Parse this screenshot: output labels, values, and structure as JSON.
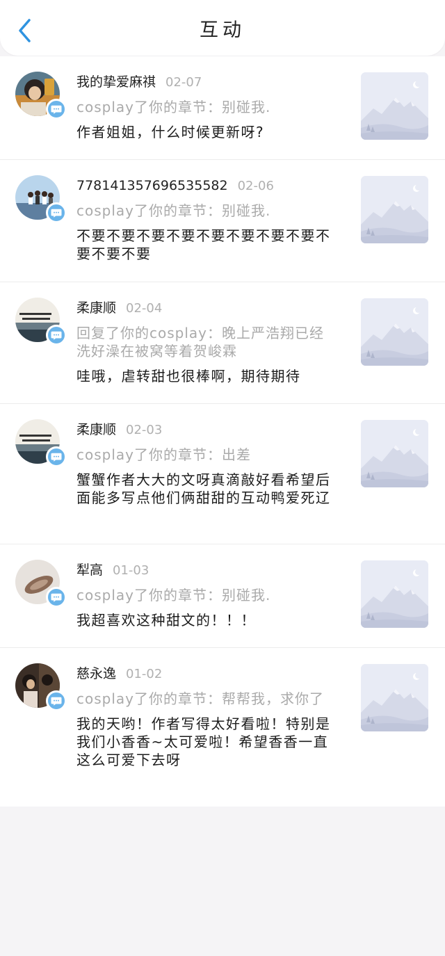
{
  "header": {
    "title": "互动",
    "back_icon": "chevron-left-icon",
    "accent": "#2f93e0"
  },
  "items": [
    {
      "name": "我的挚爱麻祺",
      "date": "02-07",
      "quote": "cosplay了你的章节：别碰我.",
      "message": "作者姐姐，什么时候更新呀?",
      "avatar": "photo-avatar-1"
    },
    {
      "name": "778141357696535582",
      "date": "02-06",
      "quote": "cosplay了你的章节：别碰我.",
      "message": "不要不要不要不要不要不要不要不要不要不要不要",
      "avatar": "photo-avatar-2"
    },
    {
      "name": "柔康顺",
      "date": "02-04",
      "quote": "回复了你的cosplay：晚上严浩翔已经洗好澡在被窝等着贺峻霖",
      "message": "哇哦，虐转甜也很棒啊，期待期待",
      "avatar": "photo-avatar-3"
    },
    {
      "name": "柔康顺",
      "date": "02-03",
      "quote": "cosplay了你的章节：出差",
      "message": "蟹蟹作者大大的文呀真滴敲好看希望后面能多写点他们俩甜甜的互动鸭爱死辽",
      "avatar": "photo-avatar-3"
    },
    {
      "name": "犁高",
      "date": "01-03",
      "quote": "cosplay了你的章节：别碰我.",
      "message": "我超喜欢这种甜文的！！！",
      "avatar": "photo-avatar-5"
    },
    {
      "name": "慈永逸",
      "date": "01-02",
      "quote": "cosplay了你的章节：帮帮我，求你了",
      "message": "我的天哟！作者写得太好看啦！特别是我们小香香~太可爱啦！希望香香一直这么可爱下去呀",
      "avatar": "photo-avatar-6"
    }
  ],
  "badge_icon": "message-bubble-icon",
  "thumbnail_icon": "mountain-placeholder-icon",
  "colors": {
    "badge": "#6ab4ea",
    "placeholder": "#e9ecf5",
    "muted_text": "#aaaaaa"
  }
}
